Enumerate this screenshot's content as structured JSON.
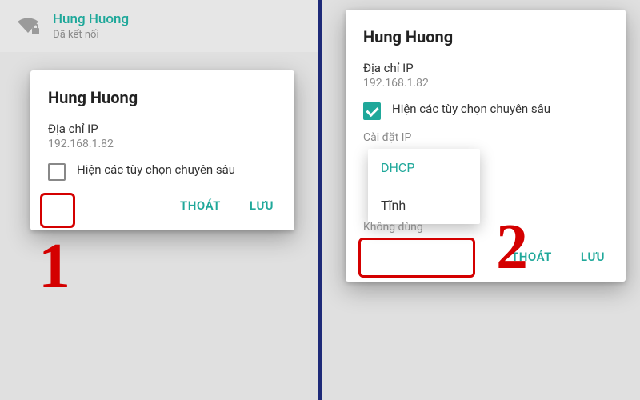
{
  "wifi": {
    "ssid": "Hung Huong",
    "status": "Đã kết nối"
  },
  "dialog1": {
    "title": "Hung Huong",
    "ip_label": "Địa chỉ IP",
    "ip_value": "192.168.1.82",
    "adv_label": "Hiện các tùy chọn chuyên sâu",
    "cancel": "THOÁT",
    "save": "LƯU"
  },
  "dialog2": {
    "title": "Hung Huong",
    "ip_label": "Địa chỉ IP",
    "ip_value": "192.168.1.82",
    "adv_label": "Hiện các tùy chọn chuyên sâu",
    "ip_settings_label": "Cài đặt IP",
    "options": {
      "dhcp": "DHCP",
      "static": "Tĩnh"
    },
    "truncated": "Không dùng",
    "cancel": "THOÁT",
    "save": "LƯU"
  },
  "annotations": {
    "one": "1",
    "two": "2"
  }
}
